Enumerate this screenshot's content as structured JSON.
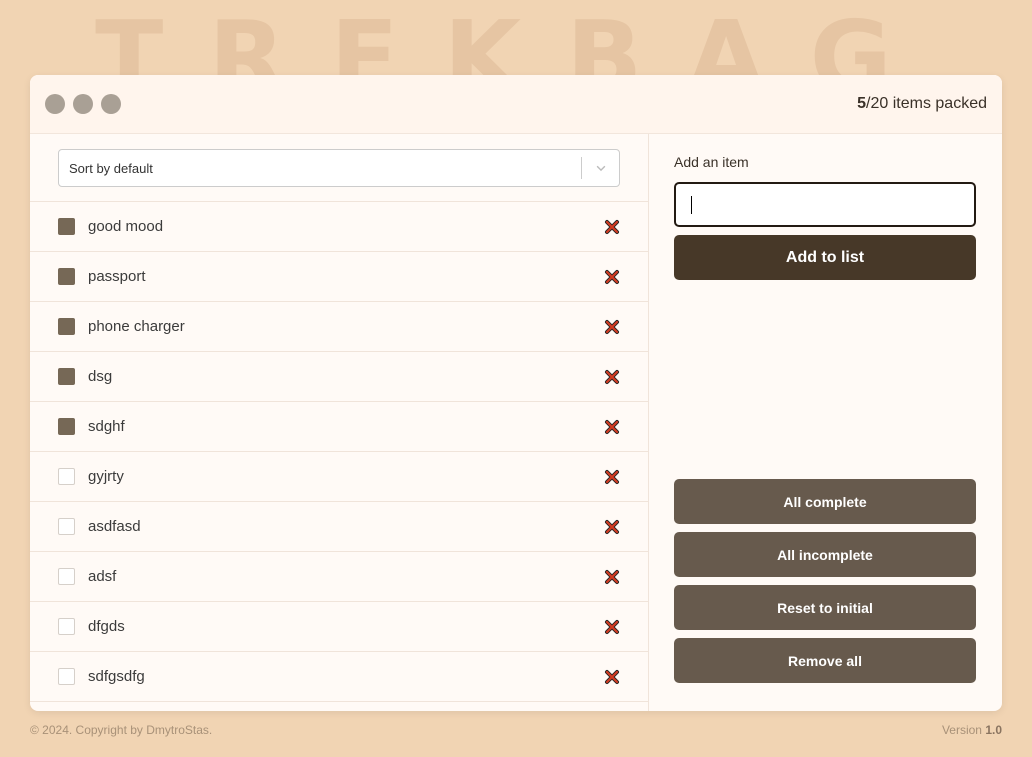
{
  "background_logo": "TREKBAG",
  "header": {
    "packed_count": "5",
    "total_label": "/20 items packed"
  },
  "sort": {
    "selected": "Sort by default"
  },
  "items": [
    {
      "label": "good mood",
      "packed": true
    },
    {
      "label": "passport",
      "packed": true
    },
    {
      "label": "phone charger",
      "packed": true
    },
    {
      "label": "dsg",
      "packed": true
    },
    {
      "label": "sdghf",
      "packed": true
    },
    {
      "label": "gyjrty",
      "packed": false
    },
    {
      "label": "asdfasd",
      "packed": false
    },
    {
      "label": "adsf",
      "packed": false
    },
    {
      "label": "dfgds",
      "packed": false
    },
    {
      "label": "sdfgsdfg",
      "packed": false
    }
  ],
  "add_form": {
    "label": "Add an item",
    "value": "",
    "button_label": "Add to list"
  },
  "actions": {
    "all_complete": "All complete",
    "all_incomplete": "All incomplete",
    "reset": "Reset to initial",
    "remove_all": "Remove all"
  },
  "footer": {
    "copyright": "© 2024. Copyright by DmytroStas.",
    "version_label": "Version ",
    "version_number": "1.0"
  },
  "colors": {
    "background": "#f1d4b3",
    "accent_dark": "#473828",
    "button_secondary": "#675a4d",
    "checkbox_checked": "#766856",
    "delete_red": "#d23b22"
  },
  "icons": {
    "delete": "close-x-icon",
    "sort_dropdown": "chevron-down-icon",
    "window_dots": "circle-icon"
  }
}
